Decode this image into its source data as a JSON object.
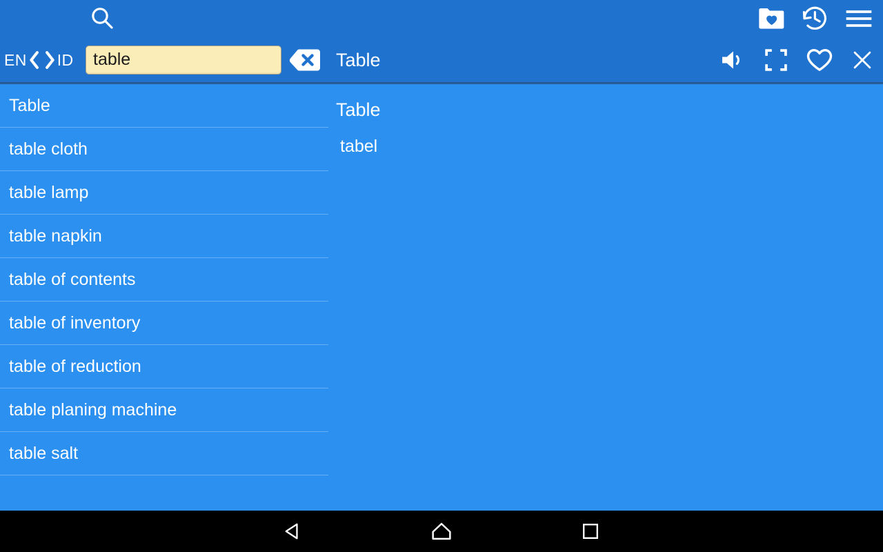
{
  "app": {
    "colors": {
      "header_blue": "#1f73cf",
      "body_blue": "#2b90f0",
      "input_yellow": "#fbedb7",
      "text_white": "#ffffff",
      "navbar_black": "#000000"
    }
  },
  "header": {
    "search_icon": "search-icon",
    "top_actions": [
      {
        "name": "favorites-folder-icon",
        "label": "Favorites"
      },
      {
        "name": "history-icon",
        "label": "History"
      },
      {
        "name": "menu-icon",
        "label": "Menu"
      }
    ],
    "language": {
      "source": "EN",
      "target": "ID",
      "prev_icon": "chevron-left-icon",
      "next_icon": "chevron-right-icon"
    },
    "search": {
      "value": "table",
      "placeholder": "Search"
    },
    "clear_icon": "backspace-icon",
    "entry_title": "Table",
    "row2_actions": [
      {
        "name": "speaker-icon",
        "label": "Pronounce"
      },
      {
        "name": "fullscreen-icon",
        "label": "Fullscreen"
      },
      {
        "name": "heart-icon",
        "label": "Add to favorites"
      },
      {
        "name": "close-icon",
        "label": "Close"
      }
    ]
  },
  "list": {
    "items": [
      {
        "label": "Table"
      },
      {
        "label": "table cloth"
      },
      {
        "label": "table lamp"
      },
      {
        "label": "table napkin"
      },
      {
        "label": "table of contents"
      },
      {
        "label": "table of inventory"
      },
      {
        "label": "table of reduction"
      },
      {
        "label": "table planing machine"
      },
      {
        "label": "table salt"
      }
    ]
  },
  "detail": {
    "headword": "Table",
    "translation": "tabel"
  },
  "navbar": {
    "back": "back-icon",
    "home": "home-icon",
    "recents": "recents-icon"
  }
}
